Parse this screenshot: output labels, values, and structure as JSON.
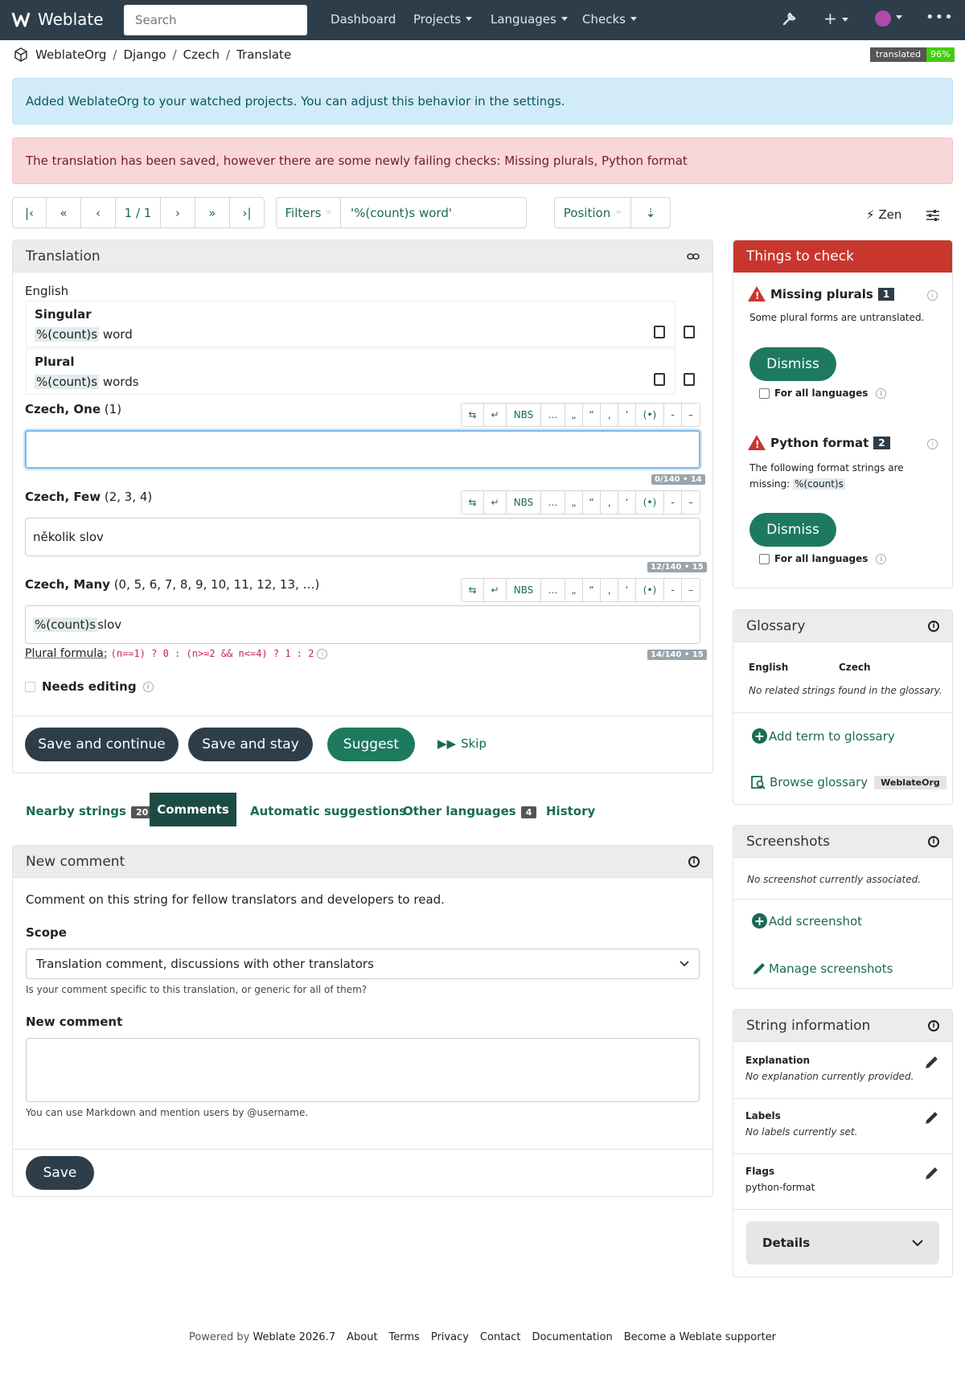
{
  "nav": {
    "brand": "Weblate",
    "search_placeholder": "Search",
    "links": [
      "Dashboard",
      "Projects",
      "Languages",
      "Checks"
    ]
  },
  "breadcrumb": [
    "WeblateOrg",
    "Django",
    "Czech",
    "Translate"
  ],
  "progress_badge": {
    "label": "translated",
    "value": "96%"
  },
  "alerts": {
    "info": "Added WeblateOrg to your watched projects. You can adjust this behavior in the settings.",
    "danger": "The translation has been saved, however there are some newly failing checks: Missing plurals, Python format"
  },
  "pager": {
    "position": "1 / 1",
    "filters_label": "Filters",
    "query": "'%(count)s word'",
    "sort_label": "Position",
    "zen_label": "Zen"
  },
  "translation": {
    "title": "Translation",
    "source_language": "English",
    "singular_label": "Singular",
    "singular_placeholder": "%(count)s",
    "singular_text": " word",
    "plural_label": "Plural",
    "plural_placeholder": "%(count)s",
    "plural_text": " words",
    "forms": [
      {
        "lang": "Czech, One",
        "nums": "(1)",
        "value": "",
        "counter": "0/140 • 14"
      },
      {
        "lang": "Czech, Few",
        "nums": "(2, 3, 4)",
        "value": "několik slov",
        "counter": "12/140 • 15"
      },
      {
        "lang": "Czech, Many",
        "nums": "(0, 5, 6, 7, 8, 9, 10, 11, 12, 13, …)",
        "value_placeholder": "%(count)s",
        "value_text": " slov",
        "counter": "14/140 • 15"
      }
    ],
    "toolbar_buttons": [
      "NBS",
      "…",
      "„",
      "“",
      "‚",
      "‘",
      "(•)",
      "-",
      "–"
    ],
    "plural_formula_label": "Plural formula:",
    "plural_formula": "(n==1) ? 0 : (n>=2 && n<=4) ? 1 : 2",
    "needs_editing": "Needs editing",
    "buttons": {
      "save_continue": "Save and continue",
      "save_stay": "Save and stay",
      "suggest": "Suggest",
      "skip": "Skip"
    }
  },
  "tabs": [
    {
      "label": "Nearby strings",
      "count": "20"
    },
    {
      "label": "Comments"
    },
    {
      "label": "Automatic suggestions"
    },
    {
      "label": "Other languages",
      "count": "4"
    },
    {
      "label": "History"
    }
  ],
  "comment": {
    "title": "New comment",
    "intro": "Comment on this string for fellow translators and developers to read.",
    "scope_label": "Scope",
    "scope_value": "Translation comment, discussions with other translators",
    "scope_help": "Is your comment specific to this translation, or generic for all of them?",
    "new_comment_label": "New comment",
    "markdown_help": "You can use Markdown and mention users by @username.",
    "save": "Save"
  },
  "checks": {
    "title": "Things to check",
    "items": [
      {
        "name": "Missing plurals",
        "count": "1",
        "desc": "Some plural forms are untranslated.",
        "dismiss": "Dismiss",
        "all_langs": "For all languages"
      },
      {
        "name": "Python format",
        "count": "2",
        "desc": "The following format strings are missing:",
        "desc_code": "%(count)s",
        "dismiss": "Dismiss",
        "all_langs": "For all languages"
      }
    ]
  },
  "glossary": {
    "title": "Glossary",
    "col_source": "English",
    "col_target": "Czech",
    "empty": "No related strings found in the glossary.",
    "add_term": "Add term to glossary",
    "browse": "Browse glossary",
    "browse_badge": "WeblateOrg"
  },
  "screenshots": {
    "title": "Screenshots",
    "empty": "No screenshot currently associated.",
    "add": "Add screenshot",
    "manage": "Manage screenshots"
  },
  "string_info": {
    "title": "String information",
    "explanation_label": "Explanation",
    "explanation_value": "No explanation currently provided.",
    "labels_label": "Labels",
    "labels_value": "No labels currently set.",
    "flags_label": "Flags",
    "flags_value": "python-format",
    "details": "Details"
  },
  "footer": {
    "powered_by": "Powered by",
    "version": "Weblate 2026.7",
    "links": [
      "About",
      "Terms",
      "Privacy",
      "Contact",
      "Documentation",
      "Become a Weblate supporter"
    ]
  }
}
